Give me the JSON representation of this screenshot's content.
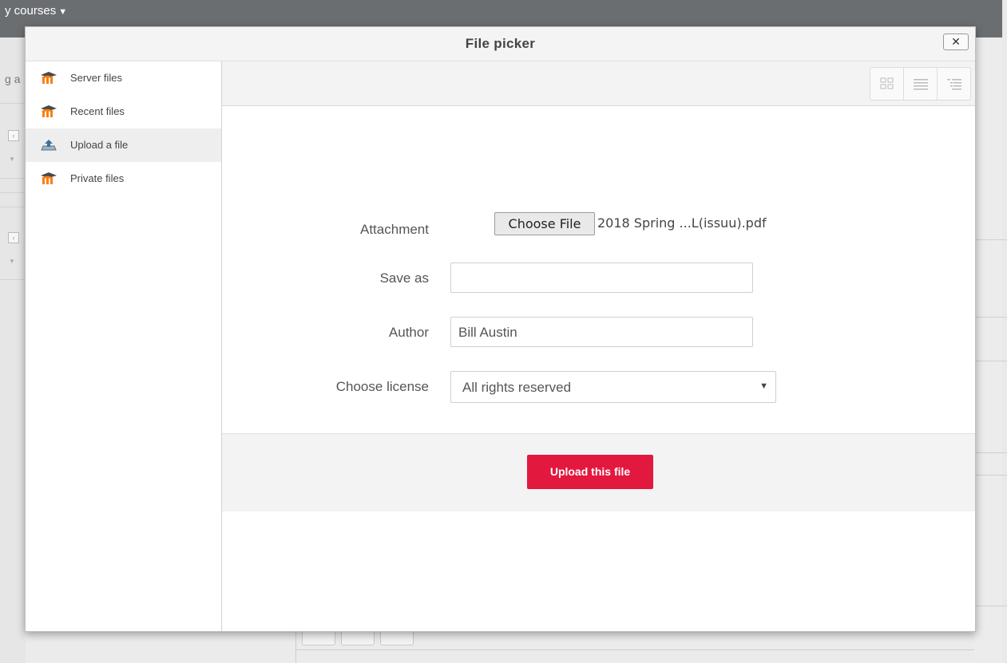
{
  "background": {
    "nav_menu_label": "y courses",
    "left_fragment_text": "g a"
  },
  "dialog": {
    "title": "File picker",
    "close_glyph": "✕"
  },
  "sidebar": {
    "items": [
      {
        "label": "Server files",
        "icon": "moodle-logo-icon",
        "active": false
      },
      {
        "label": "Recent files",
        "icon": "moodle-logo-icon",
        "active": false
      },
      {
        "label": "Upload a file",
        "icon": "upload-icon",
        "active": true
      },
      {
        "label": "Private files",
        "icon": "moodle-logo-icon",
        "active": false
      }
    ]
  },
  "toolbar": {
    "view_modes": [
      "icons-view",
      "list-view",
      "tree-view"
    ]
  },
  "form": {
    "attachment_label": "Attachment",
    "choose_file_button": "Choose File",
    "chosen_file_name": "2018 Spring ...L(issuu).pdf",
    "save_as_label": "Save as",
    "save_as_value": "",
    "author_label": "Author",
    "author_value": "Bill Austin",
    "license_label": "Choose license",
    "license_value": "All rights reserved"
  },
  "actions": {
    "upload_button": "Upload this file"
  },
  "colors": {
    "upload_button_bg": "#e3183f",
    "moodle_orange": "#f98012",
    "topbar_bg": "#6b6e71"
  }
}
